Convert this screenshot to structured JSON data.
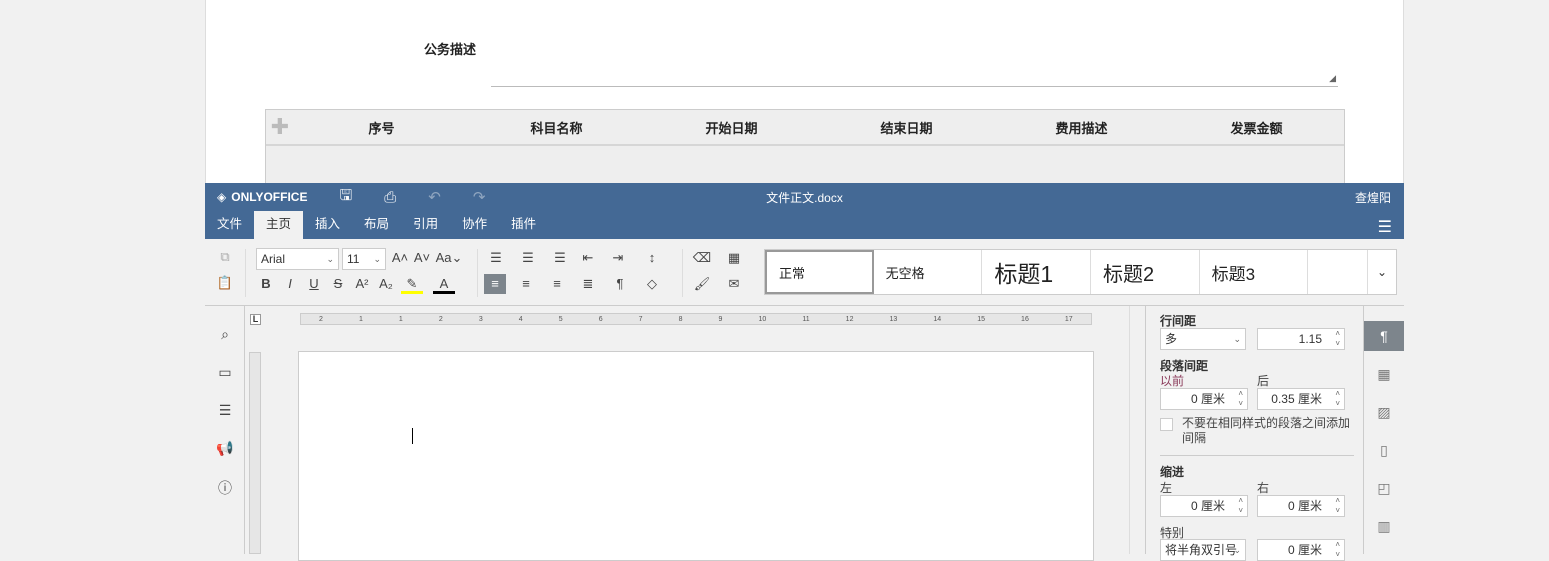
{
  "form": {
    "label": "公务描述",
    "columns": [
      "序号",
      "科目名称",
      "开始日期",
      "结束日期",
      "费用描述",
      "发票金额"
    ]
  },
  "editor": {
    "brand": "ONLYOFFICE",
    "doc_title": "文件正文.docx",
    "user": "查煌阳",
    "tabs": [
      "文件",
      "主页",
      "插入",
      "布局",
      "引用",
      "协作",
      "插件"
    ],
    "font": "Arial",
    "size": "11",
    "styles": [
      "正常",
      "无空格",
      "标题1",
      "标题2",
      "标题3"
    ],
    "ruler": [
      "2",
      "1",
      "1",
      "2",
      "3",
      "4",
      "5",
      "6",
      "7",
      "8",
      "9",
      "10",
      "11",
      "12",
      "13",
      "14",
      "15",
      "16",
      "17"
    ]
  },
  "panel": {
    "line_spacing": "行间距",
    "line_mode": "多",
    "line_value": "1.15",
    "para_spacing": "段落间距",
    "before": "以前",
    "after": "后",
    "before_val": "0 厘米",
    "after_val": "0.35 厘米",
    "no_space": "不要在相同样式的段落之间添加间隔",
    "indent": "缩进",
    "left": "左",
    "right": "右",
    "left_val": "0 厘米",
    "right_val": "0 厘米",
    "special": "特别",
    "special_mode": "将半角双引号",
    "special_val": "0 厘米"
  }
}
